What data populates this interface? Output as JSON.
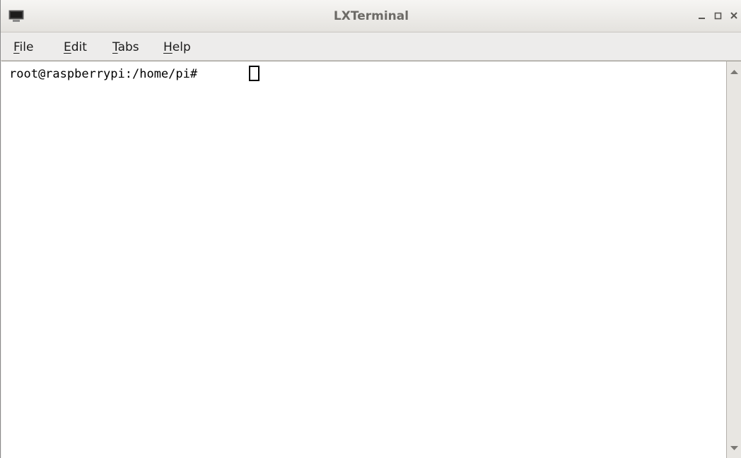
{
  "window": {
    "title": "LXTerminal",
    "icon": "terminal-icon"
  },
  "window_controls": {
    "minimize_icon": "minimize-icon",
    "maximize_icon": "maximize-icon",
    "close_icon": "close-icon"
  },
  "menubar": {
    "items": [
      {
        "mnemonic": "F",
        "rest": "ile"
      },
      {
        "mnemonic": "E",
        "rest": "dit"
      },
      {
        "mnemonic": "T",
        "rest": "abs"
      },
      {
        "mnemonic": "H",
        "rest": "elp"
      }
    ]
  },
  "terminal": {
    "prompt": "root@raspberrypi:/home/pi# ",
    "input_value": ""
  },
  "scrollbar": {
    "up_icon": "scroll-up-arrow-icon",
    "down_icon": "scroll-down-arrow-icon"
  },
  "colors": {
    "terminal_background": "#ffffff",
    "terminal_foreground": "#000000",
    "chrome": "#edeceb"
  }
}
